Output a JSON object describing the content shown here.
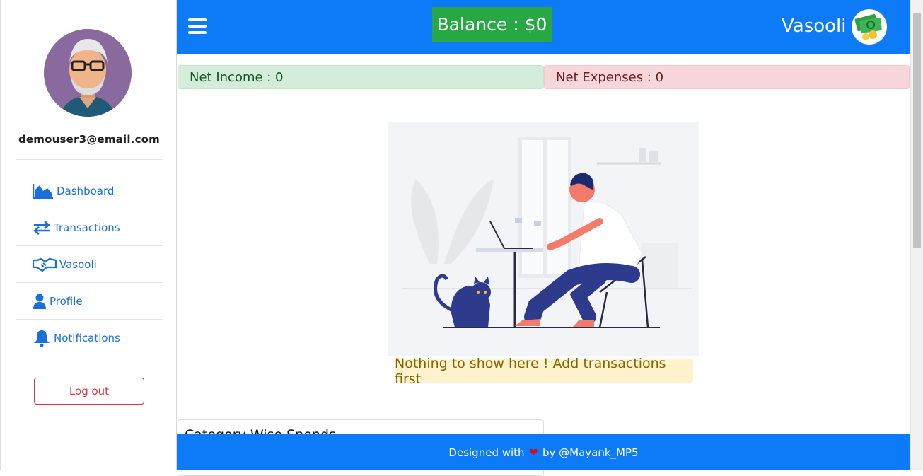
{
  "sidebar": {
    "email": "demouser3@email.com",
    "items": [
      {
        "label": "Dashboard",
        "icon": "chart-area-icon"
      },
      {
        "label": "Transactions",
        "icon": "exchange-arrows-icon"
      },
      {
        "label": "Vasooli",
        "icon": "handshake-icon"
      },
      {
        "label": "Profile",
        "icon": "user-icon"
      },
      {
        "label": "Notifications",
        "icon": "bell-icon"
      }
    ],
    "logout_label": "Log out"
  },
  "header": {
    "balance": "Balance : $0",
    "brand": "Vasooli"
  },
  "summary": {
    "net_income": "Net Income : 0",
    "net_expenses": "Net Expenses : 0"
  },
  "empty_state": {
    "message": "Nothing to show here ! Add transactions first"
  },
  "card": {
    "title": "Category Wise Spends"
  },
  "footer": {
    "prefix": "Designed with",
    "suffix": "by @Mayank_MP5"
  },
  "colors": {
    "primary": "#0d7bf7",
    "success": "#28a745",
    "danger": "#dc3545",
    "warning_bg": "#fff3cd"
  }
}
